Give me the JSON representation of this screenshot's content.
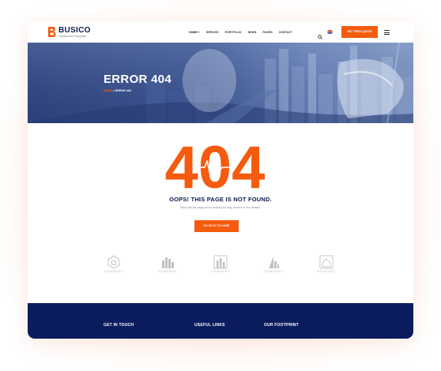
{
  "brand": {
    "name": "BUSICO",
    "tagline": "Construction Template",
    "accent": "#f45b0e",
    "navy": "#0e1a4f"
  },
  "nav": {
    "items": [
      "HOME +",
      "SERVICE",
      "PORTFOLIO",
      "NEWS",
      "PAGES",
      "CONTACT"
    ]
  },
  "header": {
    "quote_label": "GET FREE QUOTE",
    "search_icon": "search-icon",
    "flag_icon": "flag-icon",
    "menu_icon": "hamburger-icon"
  },
  "banner": {
    "title": "ERROR 404",
    "breadcrumb_home": "HOME",
    "breadcrumb_sep": ">",
    "breadcrumb_current": "ERROR 404"
  },
  "error": {
    "code": "404",
    "heading": "OOPS! THIS PAGE IS NOT FOUND.",
    "message": "Sorry but the page you're looking for may broken or not created.",
    "button_label": "GO BACK TO HOME"
  },
  "partners": [
    "COMPANY",
    "COMPANY",
    "COMPANY",
    "COMPANY",
    "COMPANY"
  ],
  "footer": {
    "columns": [
      {
        "title": "GET IN TOUCH"
      },
      {
        "title": "USEFUL LINKS"
      },
      {
        "title": "OUR FOOTPRINT"
      }
    ]
  }
}
